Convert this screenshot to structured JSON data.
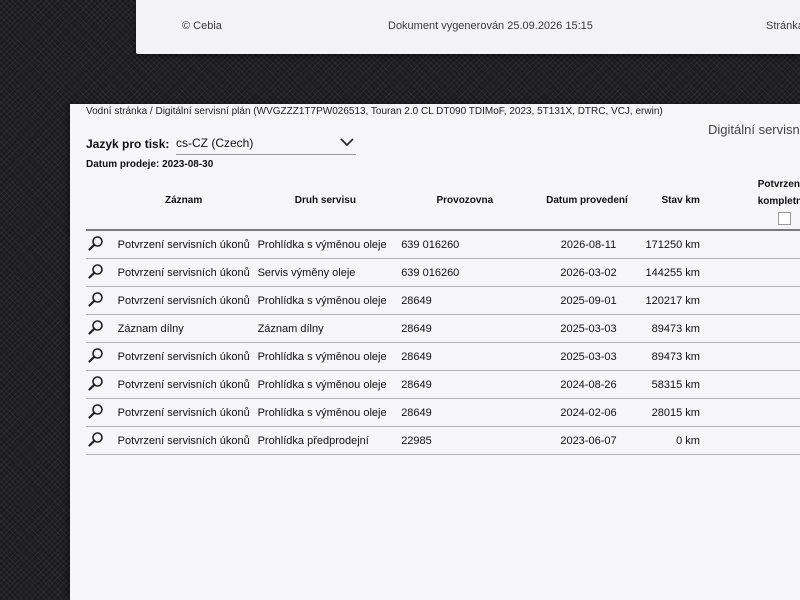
{
  "top_sheet": {
    "copyright": "© Cebia",
    "generated": "Dokument vygenerován 25.09.2026 15:15",
    "page_label": "Stránka"
  },
  "header": {
    "breadcrumb": "Vodní stránka / Digitální servisní plán (WVGZZZ1T7PW026513, Touran 2.0 CL DT090 TDIMoF, 2023, 5T131X, DTRC, VCJ, erwin)",
    "right_title": "Digitální servisní",
    "language_label": "Jazyk pro tisk:",
    "language_value": "cs-CZ (Czech)",
    "sale_date": "Datum prodeje: 2023-08-30"
  },
  "table": {
    "columns": {
      "record": "Záznam",
      "service_type": "Druh servisu",
      "workshop": "Provozovna",
      "date": "Datum provedení",
      "km": "Stav km",
      "confirm_line1": "Potvrzení",
      "confirm_line2": "kompletní"
    },
    "rows": [
      {
        "record": "Potvrzení servisních úkonů",
        "service_type": "Prohlídka s výměnou oleje",
        "workshop": "639 016260",
        "date": "2026-08-11",
        "km": "171250 km"
      },
      {
        "record": "Potvrzení servisních úkonů",
        "service_type": "Servis výměny oleje",
        "workshop": "639 016260",
        "date": "2026-03-02",
        "km": "144255 km"
      },
      {
        "record": "Potvrzení servisních úkonů",
        "service_type": "Prohlídka s výměnou oleje",
        "workshop": "28649",
        "date": "2025-09-01",
        "km": "120217 km"
      },
      {
        "record": "Záznam dílny",
        "service_type": "Záznam dílny",
        "workshop": "28649",
        "date": "2025-03-03",
        "km": "89473 km"
      },
      {
        "record": "Potvrzení servisních úkonů",
        "service_type": "Prohlídka s výměnou oleje",
        "workshop": "28649",
        "date": "2025-03-03",
        "km": "89473 km"
      },
      {
        "record": "Potvrzení servisních úkonů",
        "service_type": "Prohlídka s výměnou oleje",
        "workshop": "28649",
        "date": "2024-08-26",
        "km": "58315 km"
      },
      {
        "record": "Potvrzení servisních úkonů",
        "service_type": "Prohlídka s výměnou oleje",
        "workshop": "28649",
        "date": "2024-02-06",
        "km": "28015 km"
      },
      {
        "record": "Potvrzení servisních úkonů",
        "service_type": "Prohlídka předprodejní",
        "workshop": "22985",
        "date": "2023-06-07",
        "km": "0 km"
      }
    ]
  }
}
